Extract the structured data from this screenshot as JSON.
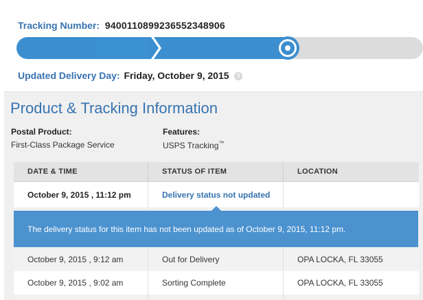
{
  "tracking": {
    "label": "Tracking Number:",
    "number": "9400110899236552348906"
  },
  "progress": {
    "fill_color": "#3b8fd0",
    "track_color": "#dcdcdc",
    "fraction_complete": 0.68
  },
  "updated": {
    "label": "Updated Delivery Day:",
    "value": "Friday, October 9, 2015",
    "help_icon": "?"
  },
  "section": {
    "title": "Product & Tracking Information"
  },
  "product": {
    "postal_label": "Postal Product:",
    "postal_value": "First-Class Package Service",
    "features_label": "Features:",
    "features_value": "USPS Tracking",
    "features_mark": "™"
  },
  "table": {
    "headers": [
      "DATE & TIME",
      "STATUS OF ITEM",
      "LOCATION"
    ],
    "first_row": {
      "date": "October 9, 2015 , 11:12 pm",
      "status": "Delivery status not updated",
      "location": ""
    },
    "callout": "The delivery status for this item has not been updated as of October 9, 2015, 11:12 pm.",
    "rows": [
      {
        "date": "October 9, 2015 , 9:12 am",
        "status": "Out for Delivery",
        "location": "OPA LOCKA, FL 33055"
      },
      {
        "date": "October 9, 2015 , 9:02 am",
        "status": "Sorting Complete",
        "location": "OPA LOCKA, FL 33055"
      }
    ]
  },
  "colors": {
    "accent": "#3773b0",
    "callout_bg": "#4b92cf"
  }
}
